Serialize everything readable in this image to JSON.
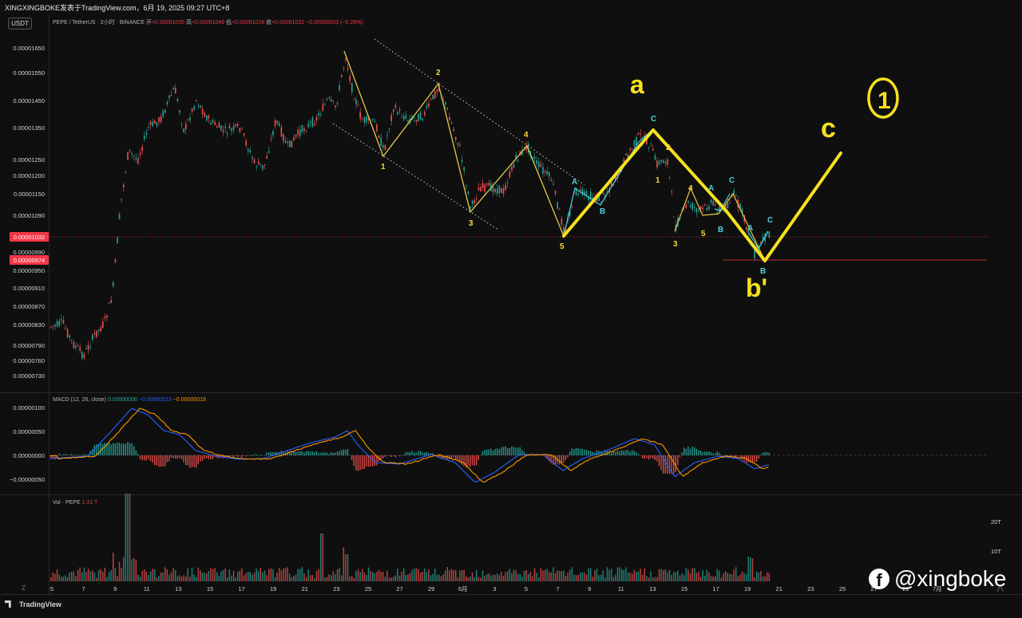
{
  "header": {
    "publisher_line": "XINGXINGBOKE发表于TradingView.com，6月 19, 2025 09:27 UTC+8"
  },
  "quote_currency": "USDT",
  "legend": {
    "symbol": "PEPE / TetherUS · 2小时 · BINANCE",
    "open_label": "开",
    "open": "=0.00001035",
    "high_label": "高",
    "high": "=0.00001049",
    "low_label": "低",
    "low": "=0.00001028",
    "close_label": "收",
    "close": "=0.00001032",
    "change": "−0.00000003 (−0.29%)"
  },
  "price_axis": {
    "ticks": [
      "0.00001650",
      "0.00001550",
      "0.00001450",
      "0.00001350",
      "0.00001250",
      "0.00001200",
      "0.00001150",
      "0.00001090",
      "0.00000990",
      "0.00000950",
      "0.00000910",
      "0.00000870",
      "0.00000830",
      "0.00000790",
      "0.00000760",
      "0.00000730"
    ],
    "current_price_tag": "0.00001032",
    "support_price_tag": "0.00000974"
  },
  "macd": {
    "label": "MACD (12, 26, close)",
    "macd_value": "0.00000006",
    "signal_value": "−0.00000013",
    "hist_value": "−0.00000019",
    "axis_ticks": [
      "0.00000100",
      "0.00000050",
      "0.00000000",
      "−0.00000050"
    ]
  },
  "volume": {
    "label": "Vol · PEPE",
    "value": "1.31 T",
    "axis_ticks": [
      "20T",
      "10T"
    ]
  },
  "time_axis": {
    "ticks": [
      "5",
      "7",
      "9",
      "11",
      "13",
      "15",
      "17",
      "19",
      "21",
      "23",
      "25",
      "27",
      "29",
      "6月",
      "3",
      "5",
      "7",
      "9",
      "11",
      "13",
      "15",
      "17",
      "19",
      "21",
      "23",
      "25",
      "27",
      "29",
      "7月"
    ]
  },
  "wave_labels": {
    "impulse": [
      "1",
      "2",
      "3",
      "4",
      "5"
    ],
    "second_impulse": [
      "1",
      "2",
      "3",
      "4",
      "5"
    ],
    "abc": [
      "A",
      "B",
      "C"
    ],
    "hand_a": "a",
    "hand_b": "b'",
    "hand_c": "c",
    "hand_circle": "1"
  },
  "colors": {
    "up": "#26a69a",
    "down": "#ef5350",
    "wave_yellow": "#ffeb3b",
    "macd_blue": "#2962ff",
    "signal_orange": "#ff9800",
    "label_cyan": "#4dd0e1",
    "price_tag_red": "#f23645"
  },
  "branding": {
    "tradingview": "TradingView",
    "watermark": "@xingboke"
  },
  "controls": {
    "timezone_button": "Z"
  }
}
